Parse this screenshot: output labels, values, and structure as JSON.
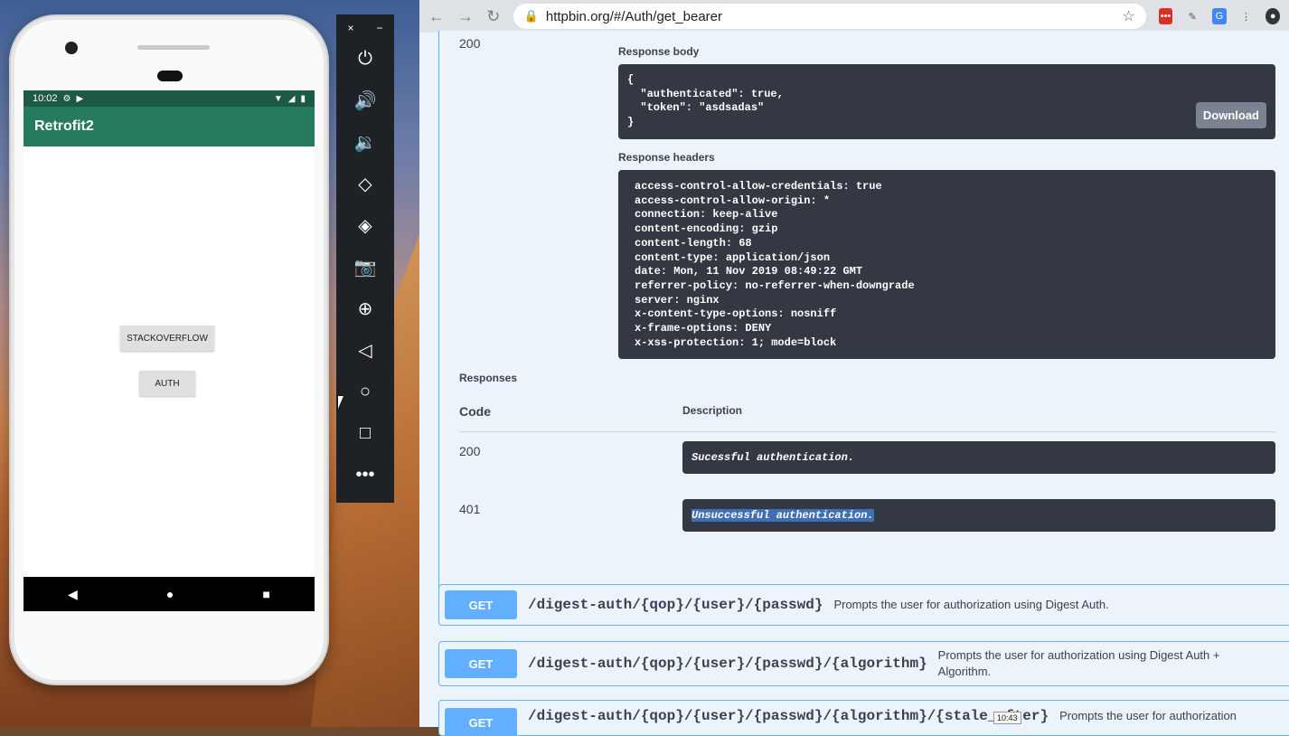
{
  "phone": {
    "status_time": "10:02",
    "app_title": "Retrofit2",
    "buttons": {
      "stackoverflow": "STACKOVERFLOW",
      "auth": "AUTH"
    }
  },
  "emulator": {
    "close": "×",
    "minimize": "−"
  },
  "browser": {
    "url": "httpbin.org/#/Auth/get_bearer"
  },
  "response": {
    "code": "200",
    "body_label": "Response body",
    "body_text": "{\n  \"authenticated\": true,\n  \"token\": \"asdsadas\"\n}",
    "download_label": "Download",
    "headers_label": "Response headers",
    "headers_text": "access-control-allow-credentials: true\naccess-control-allow-origin: *\nconnection: keep-alive\ncontent-encoding: gzip\ncontent-length: 68\ncontent-type: application/json\ndate: Mon, 11 Nov 2019 08:49:22 GMT\nreferrer-policy: no-referrer-when-downgrade\nserver: nginx\nx-content-type-options: nosniff\nx-frame-options: DENY\nx-xss-protection: 1; mode=block"
  },
  "responses": {
    "title": "Responses",
    "col_code": "Code",
    "col_description": "Description",
    "rows": [
      {
        "code": "200",
        "description": "Sucessful authentication."
      },
      {
        "code": "401",
        "description": "Unsuccessful authentication."
      }
    ]
  },
  "endpoints": [
    {
      "method": "GET",
      "path": "/digest-auth/{qop}/{user}/{passwd}",
      "description": "Prompts the user for authorization using Digest Auth."
    },
    {
      "method": "GET",
      "path": "/digest-auth/{qop}/{user}/{passwd}/{algorithm}",
      "description": "Prompts the user for authorization using Digest Auth + Algorithm."
    },
    {
      "method": "GET",
      "path": "/digest-auth/{qop}/{user}/{passwd}/{algorithm}/{stale_after}",
      "description": "Prompts the user for authorization"
    }
  ],
  "tooltip": "10:43",
  "colors": {
    "swagger_get": "#61affe",
    "dark_block": "#333842",
    "app_bar": "#257a60"
  }
}
